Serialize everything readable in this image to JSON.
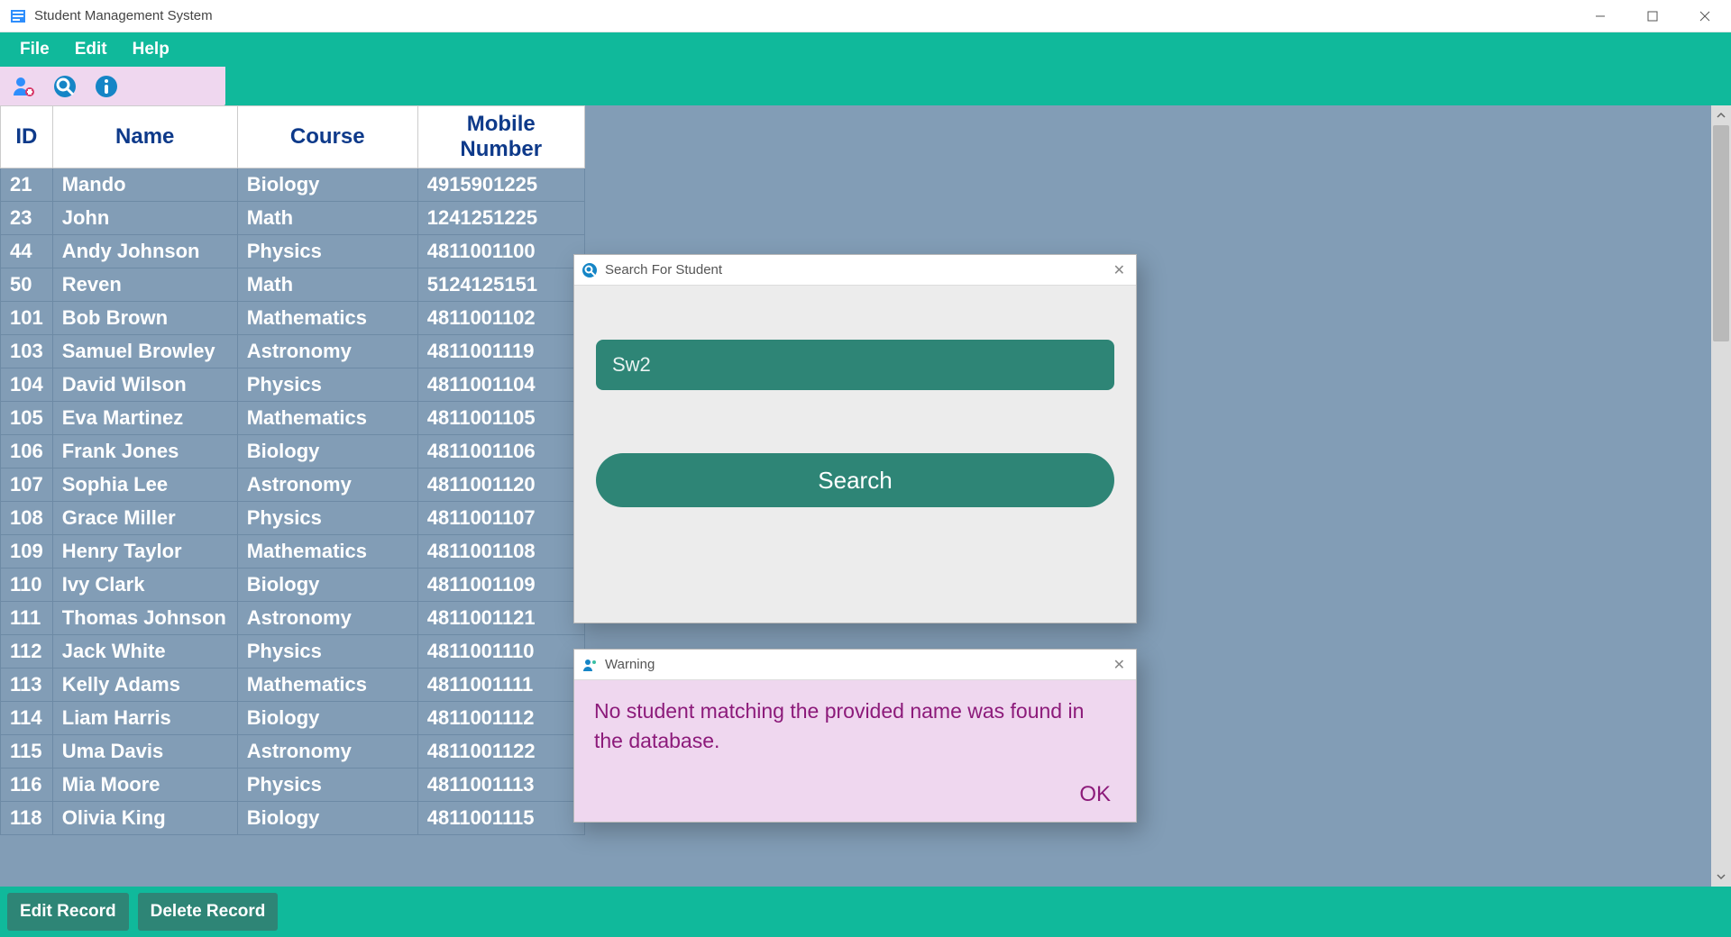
{
  "window": {
    "title": "Student Management System"
  },
  "menubar": {
    "file": "File",
    "edit": "Edit",
    "help": "Help"
  },
  "table": {
    "headers": [
      "ID",
      "Name",
      "Course",
      "Mobile Number"
    ],
    "rows": [
      {
        "id": "21",
        "name": "Mando",
        "course": "Biology",
        "mobile": "4915901225"
      },
      {
        "id": "23",
        "name": "John",
        "course": "Math",
        "mobile": "1241251225"
      },
      {
        "id": "44",
        "name": "Andy Johnson",
        "course": "Physics",
        "mobile": "4811001100"
      },
      {
        "id": "50",
        "name": "Reven",
        "course": "Math",
        "mobile": "5124125151"
      },
      {
        "id": "101",
        "name": "Bob Brown",
        "course": "Mathematics",
        "mobile": "4811001102"
      },
      {
        "id": "103",
        "name": "Samuel Browley",
        "course": "Astronomy",
        "mobile": "4811001119"
      },
      {
        "id": "104",
        "name": "David Wilson",
        "course": "Physics",
        "mobile": "4811001104"
      },
      {
        "id": "105",
        "name": "Eva Martinez",
        "course": "Mathematics",
        "mobile": "4811001105"
      },
      {
        "id": "106",
        "name": "Frank Jones",
        "course": "Biology",
        "mobile": "4811001106"
      },
      {
        "id": "107",
        "name": "Sophia Lee",
        "course": "Astronomy",
        "mobile": "4811001120"
      },
      {
        "id": "108",
        "name": "Grace Miller",
        "course": "Physics",
        "mobile": "4811001107"
      },
      {
        "id": "109",
        "name": "Henry Taylor",
        "course": "Mathematics",
        "mobile": "4811001108"
      },
      {
        "id": "110",
        "name": "Ivy Clark",
        "course": "Biology",
        "mobile": "4811001109"
      },
      {
        "id": "111",
        "name": "Thomas Johnson",
        "course": "Astronomy",
        "mobile": "4811001121"
      },
      {
        "id": "112",
        "name": "Jack White",
        "course": "Physics",
        "mobile": "4811001110"
      },
      {
        "id": "113",
        "name": "Kelly Adams",
        "course": "Mathematics",
        "mobile": "4811001111"
      },
      {
        "id": "114",
        "name": "Liam Harris",
        "course": "Biology",
        "mobile": "4811001112"
      },
      {
        "id": "115",
        "name": "Uma Davis",
        "course": "Astronomy",
        "mobile": "4811001122"
      },
      {
        "id": "116",
        "name": "Mia Moore",
        "course": "Physics",
        "mobile": "4811001113"
      },
      {
        "id": "118",
        "name": "Olivia King",
        "course": "Biology",
        "mobile": "4811001115"
      }
    ]
  },
  "footer": {
    "edit": "Edit Record",
    "delete": "Delete Record"
  },
  "search_dialog": {
    "title": "Search For Student",
    "value": "Sw2",
    "button": "Search"
  },
  "warning_dialog": {
    "title": "Warning",
    "message": "No student matching the provided name was found in the database.",
    "ok": "OK"
  }
}
